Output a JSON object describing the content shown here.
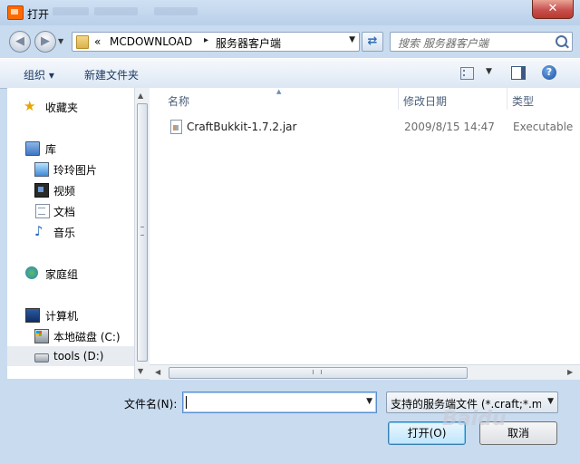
{
  "window": {
    "title": "打开",
    "close_glyph": "✕"
  },
  "address": {
    "crumb_prefix": "«",
    "crumbs": [
      "MCDOWNLOAD",
      "服务器客户端"
    ],
    "separator": "▸",
    "search_placeholder": "搜索 服务器客户端"
  },
  "toolbar": {
    "organize_label": "组织 ▾",
    "new_folder_label": "新建文件夹",
    "help_glyph": "?"
  },
  "sidebar": {
    "items": [
      {
        "label": "收藏夹",
        "icon": "star-icon"
      },
      {
        "label": "库",
        "icon": "library-icon"
      },
      {
        "label": "玲玲图片",
        "icon": "pictures-icon"
      },
      {
        "label": "视频",
        "icon": "video-icon"
      },
      {
        "label": "文档",
        "icon": "document-icon"
      },
      {
        "label": "音乐",
        "icon": "music-icon"
      },
      {
        "label": "家庭组",
        "icon": "homegroup-icon"
      },
      {
        "label": "计算机",
        "icon": "computer-icon"
      },
      {
        "label": "本地磁盘 (C:)",
        "icon": "local-disk-icon"
      },
      {
        "label": "tools (D:)",
        "icon": "drive-icon",
        "selected": true
      }
    ]
  },
  "files": {
    "columns": [
      "名称",
      "修改日期",
      "类型"
    ],
    "rows": [
      {
        "name": "CraftBukkit-1.7.2.jar",
        "date": "2009/8/15 14:47",
        "type": "Executable"
      }
    ]
  },
  "bottom": {
    "filename_label": "文件名(N):",
    "filename_value": "",
    "filter_value": "支持的服务端文件 (*.craft;*.mcp",
    "open_label": "打开(O)",
    "cancel_label": "取消"
  }
}
